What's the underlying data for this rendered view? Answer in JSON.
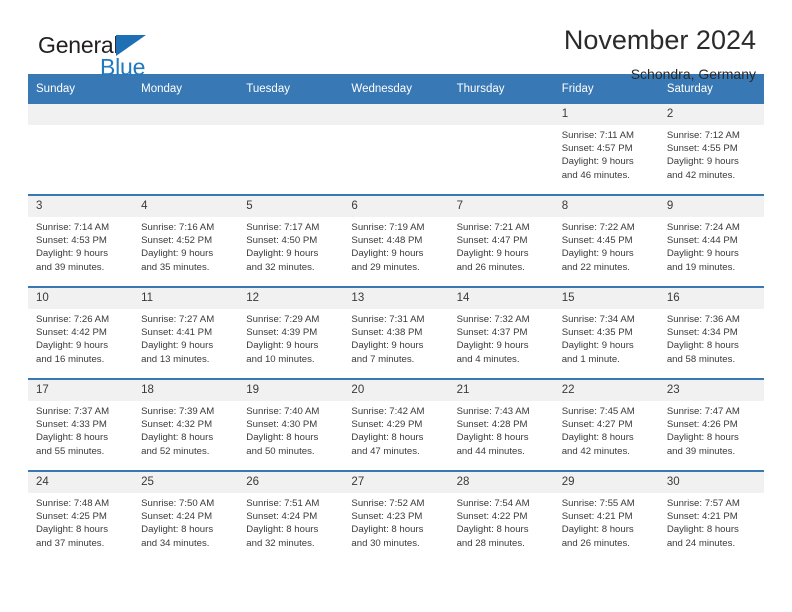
{
  "brand": {
    "name_top": "General",
    "name_bottom": "Blue",
    "triangle_color": "#1f6fb5",
    "blue_color": "#1f7ac0"
  },
  "header": {
    "title": "November 2024",
    "subtitle": "Schondra, Germany"
  },
  "theme": {
    "header_blue": "#3878b4",
    "date_band": "#f1f1f1",
    "text": "#3a3a3a"
  },
  "labels": {
    "sunrise_prefix": "Sunrise:",
    "sunset_prefix": "Sunset:",
    "daylight_prefix": "Daylight:"
  },
  "weekday_headers": [
    "Sunday",
    "Monday",
    "Tuesday",
    "Wednesday",
    "Thursday",
    "Friday",
    "Saturday"
  ],
  "weeks": [
    [
      {
        "day": "",
        "sunrise": "",
        "sunset": "",
        "daylight_line1": "",
        "daylight_line2": "",
        "empty": true
      },
      {
        "day": "",
        "sunrise": "",
        "sunset": "",
        "daylight_line1": "",
        "daylight_line2": "",
        "empty": true
      },
      {
        "day": "",
        "sunrise": "",
        "sunset": "",
        "daylight_line1": "",
        "daylight_line2": "",
        "empty": true
      },
      {
        "day": "",
        "sunrise": "",
        "sunset": "",
        "daylight_line1": "",
        "daylight_line2": "",
        "empty": true
      },
      {
        "day": "",
        "sunrise": "",
        "sunset": "",
        "daylight_line1": "",
        "daylight_line2": "",
        "empty": true
      },
      {
        "day": "1",
        "sunrise": "Sunrise: 7:11 AM",
        "sunset": "Sunset: 4:57 PM",
        "daylight_line1": "Daylight: 9 hours",
        "daylight_line2": "and 46 minutes.",
        "empty": false
      },
      {
        "day": "2",
        "sunrise": "Sunrise: 7:12 AM",
        "sunset": "Sunset: 4:55 PM",
        "daylight_line1": "Daylight: 9 hours",
        "daylight_line2": "and 42 minutes.",
        "empty": false
      }
    ],
    [
      {
        "day": "3",
        "sunrise": "Sunrise: 7:14 AM",
        "sunset": "Sunset: 4:53 PM",
        "daylight_line1": "Daylight: 9 hours",
        "daylight_line2": "and 39 minutes.",
        "empty": false
      },
      {
        "day": "4",
        "sunrise": "Sunrise: 7:16 AM",
        "sunset": "Sunset: 4:52 PM",
        "daylight_line1": "Daylight: 9 hours",
        "daylight_line2": "and 35 minutes.",
        "empty": false
      },
      {
        "day": "5",
        "sunrise": "Sunrise: 7:17 AM",
        "sunset": "Sunset: 4:50 PM",
        "daylight_line1": "Daylight: 9 hours",
        "daylight_line2": "and 32 minutes.",
        "empty": false
      },
      {
        "day": "6",
        "sunrise": "Sunrise: 7:19 AM",
        "sunset": "Sunset: 4:48 PM",
        "daylight_line1": "Daylight: 9 hours",
        "daylight_line2": "and 29 minutes.",
        "empty": false
      },
      {
        "day": "7",
        "sunrise": "Sunrise: 7:21 AM",
        "sunset": "Sunset: 4:47 PM",
        "daylight_line1": "Daylight: 9 hours",
        "daylight_line2": "and 26 minutes.",
        "empty": false
      },
      {
        "day": "8",
        "sunrise": "Sunrise: 7:22 AM",
        "sunset": "Sunset: 4:45 PM",
        "daylight_line1": "Daylight: 9 hours",
        "daylight_line2": "and 22 minutes.",
        "empty": false
      },
      {
        "day": "9",
        "sunrise": "Sunrise: 7:24 AM",
        "sunset": "Sunset: 4:44 PM",
        "daylight_line1": "Daylight: 9 hours",
        "daylight_line2": "and 19 minutes.",
        "empty": false
      }
    ],
    [
      {
        "day": "10",
        "sunrise": "Sunrise: 7:26 AM",
        "sunset": "Sunset: 4:42 PM",
        "daylight_line1": "Daylight: 9 hours",
        "daylight_line2": "and 16 minutes.",
        "empty": false
      },
      {
        "day": "11",
        "sunrise": "Sunrise: 7:27 AM",
        "sunset": "Sunset: 4:41 PM",
        "daylight_line1": "Daylight: 9 hours",
        "daylight_line2": "and 13 minutes.",
        "empty": false
      },
      {
        "day": "12",
        "sunrise": "Sunrise: 7:29 AM",
        "sunset": "Sunset: 4:39 PM",
        "daylight_line1": "Daylight: 9 hours",
        "daylight_line2": "and 10 minutes.",
        "empty": false
      },
      {
        "day": "13",
        "sunrise": "Sunrise: 7:31 AM",
        "sunset": "Sunset: 4:38 PM",
        "daylight_line1": "Daylight: 9 hours",
        "daylight_line2": "and 7 minutes.",
        "empty": false
      },
      {
        "day": "14",
        "sunrise": "Sunrise: 7:32 AM",
        "sunset": "Sunset: 4:37 PM",
        "daylight_line1": "Daylight: 9 hours",
        "daylight_line2": "and 4 minutes.",
        "empty": false
      },
      {
        "day": "15",
        "sunrise": "Sunrise: 7:34 AM",
        "sunset": "Sunset: 4:35 PM",
        "daylight_line1": "Daylight: 9 hours",
        "daylight_line2": "and 1 minute.",
        "empty": false
      },
      {
        "day": "16",
        "sunrise": "Sunrise: 7:36 AM",
        "sunset": "Sunset: 4:34 PM",
        "daylight_line1": "Daylight: 8 hours",
        "daylight_line2": "and 58 minutes.",
        "empty": false
      }
    ],
    [
      {
        "day": "17",
        "sunrise": "Sunrise: 7:37 AM",
        "sunset": "Sunset: 4:33 PM",
        "daylight_line1": "Daylight: 8 hours",
        "daylight_line2": "and 55 minutes.",
        "empty": false
      },
      {
        "day": "18",
        "sunrise": "Sunrise: 7:39 AM",
        "sunset": "Sunset: 4:32 PM",
        "daylight_line1": "Daylight: 8 hours",
        "daylight_line2": "and 52 minutes.",
        "empty": false
      },
      {
        "day": "19",
        "sunrise": "Sunrise: 7:40 AM",
        "sunset": "Sunset: 4:30 PM",
        "daylight_line1": "Daylight: 8 hours",
        "daylight_line2": "and 50 minutes.",
        "empty": false
      },
      {
        "day": "20",
        "sunrise": "Sunrise: 7:42 AM",
        "sunset": "Sunset: 4:29 PM",
        "daylight_line1": "Daylight: 8 hours",
        "daylight_line2": "and 47 minutes.",
        "empty": false
      },
      {
        "day": "21",
        "sunrise": "Sunrise: 7:43 AM",
        "sunset": "Sunset: 4:28 PM",
        "daylight_line1": "Daylight: 8 hours",
        "daylight_line2": "and 44 minutes.",
        "empty": false
      },
      {
        "day": "22",
        "sunrise": "Sunrise: 7:45 AM",
        "sunset": "Sunset: 4:27 PM",
        "daylight_line1": "Daylight: 8 hours",
        "daylight_line2": "and 42 minutes.",
        "empty": false
      },
      {
        "day": "23",
        "sunrise": "Sunrise: 7:47 AM",
        "sunset": "Sunset: 4:26 PM",
        "daylight_line1": "Daylight: 8 hours",
        "daylight_line2": "and 39 minutes.",
        "empty": false
      }
    ],
    [
      {
        "day": "24",
        "sunrise": "Sunrise: 7:48 AM",
        "sunset": "Sunset: 4:25 PM",
        "daylight_line1": "Daylight: 8 hours",
        "daylight_line2": "and 37 minutes.",
        "empty": false
      },
      {
        "day": "25",
        "sunrise": "Sunrise: 7:50 AM",
        "sunset": "Sunset: 4:24 PM",
        "daylight_line1": "Daylight: 8 hours",
        "daylight_line2": "and 34 minutes.",
        "empty": false
      },
      {
        "day": "26",
        "sunrise": "Sunrise: 7:51 AM",
        "sunset": "Sunset: 4:24 PM",
        "daylight_line1": "Daylight: 8 hours",
        "daylight_line2": "and 32 minutes.",
        "empty": false
      },
      {
        "day": "27",
        "sunrise": "Sunrise: 7:52 AM",
        "sunset": "Sunset: 4:23 PM",
        "daylight_line1": "Daylight: 8 hours",
        "daylight_line2": "and 30 minutes.",
        "empty": false
      },
      {
        "day": "28",
        "sunrise": "Sunrise: 7:54 AM",
        "sunset": "Sunset: 4:22 PM",
        "daylight_line1": "Daylight: 8 hours",
        "daylight_line2": "and 28 minutes.",
        "empty": false
      },
      {
        "day": "29",
        "sunrise": "Sunrise: 7:55 AM",
        "sunset": "Sunset: 4:21 PM",
        "daylight_line1": "Daylight: 8 hours",
        "daylight_line2": "and 26 minutes.",
        "empty": false
      },
      {
        "day": "30",
        "sunrise": "Sunrise: 7:57 AM",
        "sunset": "Sunset: 4:21 PM",
        "daylight_line1": "Daylight: 8 hours",
        "daylight_line2": "and 24 minutes.",
        "empty": false
      }
    ]
  ]
}
